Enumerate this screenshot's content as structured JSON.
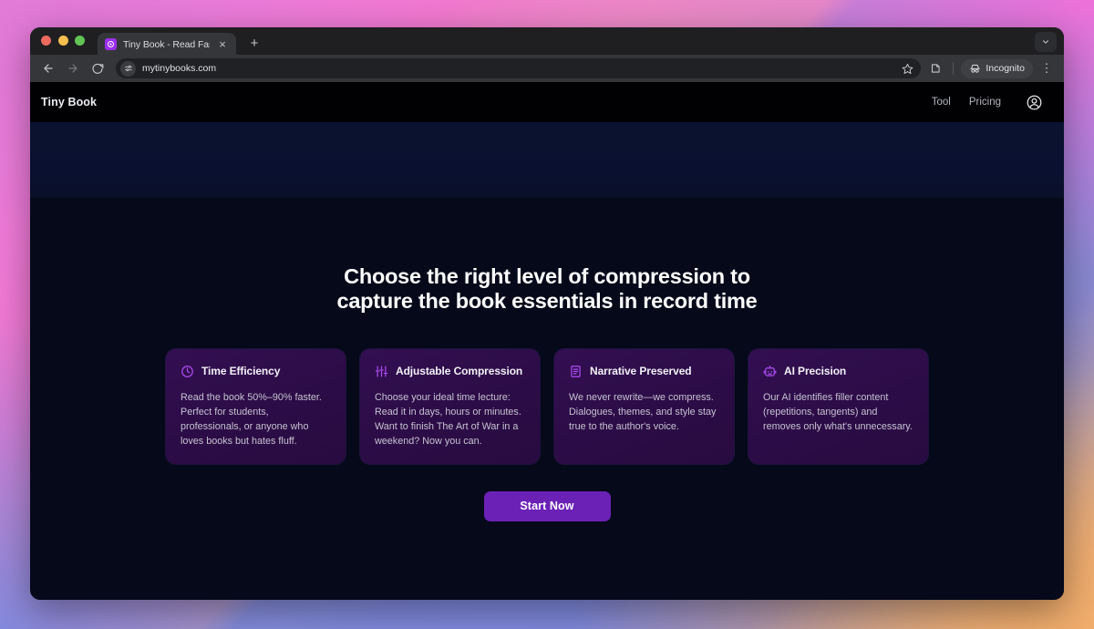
{
  "browser": {
    "tab": {
      "title": "Tiny Book - Read Faster, Sma",
      "favicon_name": "tiny-book-favicon",
      "close_label": "×"
    },
    "new_tab_label": "+",
    "toolbar": {
      "back_label": "←",
      "forward_label": "→",
      "reload_label": "⟳",
      "url": "mytinybooks.com",
      "site_info_icon": "tune-icon",
      "bookmark_icon": "star-icon",
      "extensions_icon": "extensions-icon",
      "incognito_label": "Incognito",
      "incognito_icon": "incognito-hat-icon",
      "menu_label": "⋮"
    },
    "tab_list_chevron": "chevron-down-icon"
  },
  "site": {
    "brand": "Tiny Book",
    "nav": [
      {
        "label": "Tool"
      },
      {
        "label": "Pricing"
      }
    ],
    "account_icon": "user-circle-icon"
  },
  "page": {
    "headline_line1": "Choose the right level of compression to",
    "headline_line2": "capture the book essentials in record time",
    "cards": [
      {
        "icon": "clock-icon",
        "title": "Time Efficiency",
        "body": "Read the book 50%–90% faster. Perfect for students, professionals, or anyone who loves books but hates fluff."
      },
      {
        "icon": "sliders-icon",
        "title": "Adjustable Compression",
        "body": "Choose your ideal time lecture: Read it in days, hours or minutes. Want to finish The Art of War in a weekend? Now you can."
      },
      {
        "icon": "book-icon",
        "title": "Narrative Preserved",
        "body": "We never rewrite—we compress. Dialogues, themes, and style stay true to the author's voice."
      },
      {
        "icon": "robot-icon",
        "title": "AI Precision",
        "body": "Our AI identifies filler content (repetitions, tangents) and removes only what's unnecessary."
      }
    ],
    "cta_label": "Start Now"
  },
  "colors": {
    "accent_purple": "#6b21b6",
    "icon_purple": "#b04df5",
    "card_bg": "#2c0c46",
    "page_bg": "#05091a",
    "hero_band": "#0a1230",
    "header_bg": "#010103"
  }
}
